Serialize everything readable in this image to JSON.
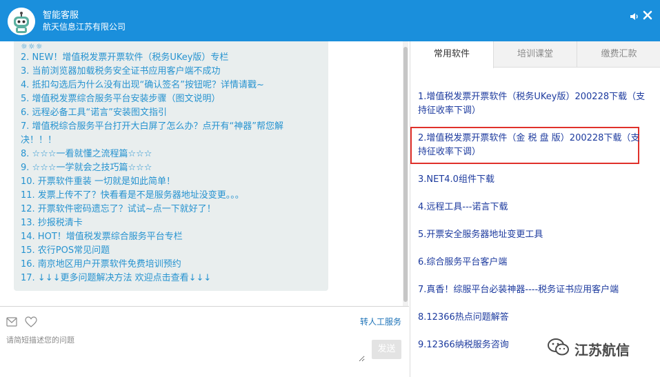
{
  "header": {
    "title": "智能客服",
    "subtitle": "航天信息江苏有限公司"
  },
  "chat": {
    "stars_top": "☼☼☼",
    "faq": [
      "2. NEW！增值税发票开票软件（税务UKey版）专栏",
      "3. 当前浏览器加载税务安全证书应用客户端不成功",
      "4. 抵扣勾选后为什么没有出现“确认签名”按钮呢？详情请戳~",
      "5. 增值税发票综合服务平台安装步骤（图文说明）",
      "6. 远程必备工具“诺言”安装图文指引",
      "7. 增值税综合服务平台打开大白屏了怎么办？点开有“神器”帮您解",
      "决！！！",
      "8. ☆☆☆一看就懂之流程篇☆☆☆",
      "9. ☆☆☆一学就会之技巧篇☆☆☆",
      "10. 开票软件重装 一切就是如此简单！",
      "11. 发票上传不了？快看看是不是服务器地址没变更。。。",
      "12. 开票软件密码遗忘了？试试~点一下就好了！",
      "13. 抄报税清卡",
      "14. HOT！增值税发票综合服务平台专栏",
      "15. 农行POS常见问题",
      "16. 南京地区用户开票软件免费培训预约",
      "17. ↓↓↓更多问题解决方法 欢迎点击查看↓↓↓"
    ]
  },
  "input": {
    "human_service_label": "转人工服务",
    "placeholder": "请简短描述您的问题",
    "send_label": "发送"
  },
  "right_panel": {
    "tabs": [
      "常用软件",
      "培训课堂",
      "缴费汇款"
    ],
    "items": [
      "1.增值税发票开票软件（税务UKey版）200228下载（支持征收率下调）",
      "2.增值税发票开票软件（金 税 盘 版）200228下载（支持征收率下调）",
      "3.NET4.0组件下载",
      "4.远程工具---诺言下载",
      "5.开票安全服务器地址变更工具",
      "6.综合服务平台客户端",
      "7.真香！综服平台必装神器----税务证书应用客户端",
      "8.12366热点问题解答",
      "9.12366纳税服务咨询"
    ]
  },
  "watermark": {
    "text": "江苏航信"
  },
  "colors": {
    "header_bg": "#1a8fdc",
    "faq_link": "#2693d0",
    "soft_link": "#1c3a9e",
    "highlight": "#e0302a"
  },
  "icons": [
    "robot-avatar-icon",
    "speaker-icon",
    "close-icon",
    "mail-icon",
    "heart-icon",
    "wechat-icon"
  ]
}
